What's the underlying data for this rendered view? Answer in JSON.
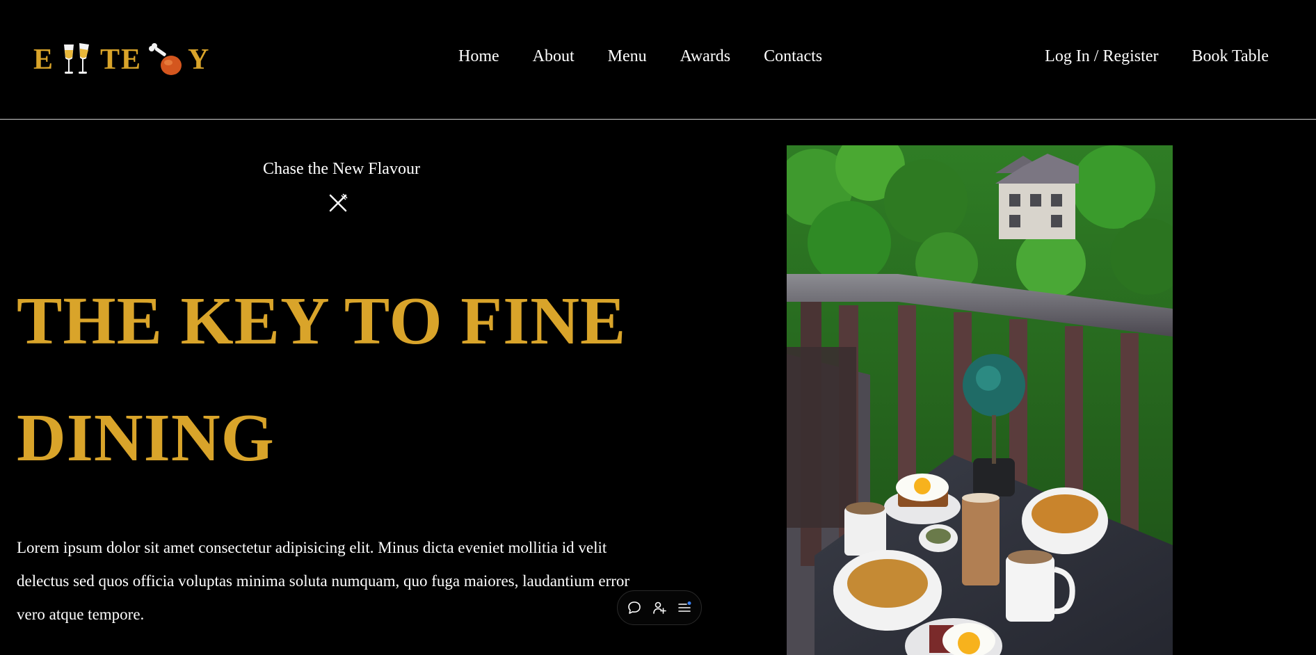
{
  "brand": {
    "letters": [
      "E",
      "TE",
      "Y"
    ],
    "accent": "#d9a42a"
  },
  "nav": {
    "items": [
      {
        "label": "Home"
      },
      {
        "label": "About"
      },
      {
        "label": "Menu"
      },
      {
        "label": "Awards"
      },
      {
        "label": "Contacts"
      }
    ]
  },
  "right_nav": {
    "login_label": "Log In / Register",
    "book_label": "Book Table"
  },
  "hero": {
    "tagline": "Chase the New Flavour",
    "headline_line1": "THE KEY TO FINE",
    "headline_line2": "DINING",
    "description": "Lorem ipsum dolor sit amet consectetur adipisicing elit. Minus dicta eveniet mollitia id velit delectus sed quos officia voluptas minima soluta numquam, quo fuga maiores, laudantium error vero atque tempore."
  },
  "toolbar": {
    "icons": [
      "chat-icon",
      "add-user-icon",
      "menu-notification-icon"
    ],
    "notify_color": "#3b82f6"
  },
  "icons": {
    "cheers": "cheers-glasses-icon",
    "drumstick": "chicken-drumstick-icon",
    "cutlery": "fork-knife-icon"
  }
}
